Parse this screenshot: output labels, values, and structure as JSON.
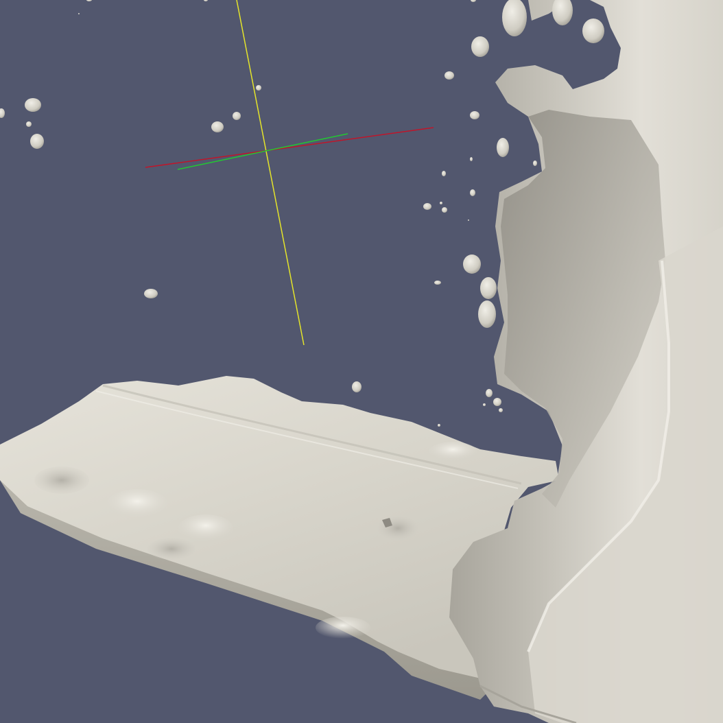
{
  "viewport": {
    "background_color": "#52576e",
    "surface_color": "#dcd9cf",
    "surface_shadow_color": "#8f8c84",
    "surface_highlight_color": "#f1efe8"
  },
  "axes_widget": {
    "x_axis_color": "#c0152a",
    "y_axis_color": "#22c832",
    "z_axis_color": "#e5e52a",
    "label": ""
  },
  "objects": [
    {
      "kind": "fluid-sheet",
      "name": "fluid-floor-sheet"
    },
    {
      "kind": "fluid-splash",
      "name": "fluid-wall-splash"
    },
    {
      "kind": "droplet-cloud",
      "name": "spray-droplets",
      "count": 30
    }
  ]
}
